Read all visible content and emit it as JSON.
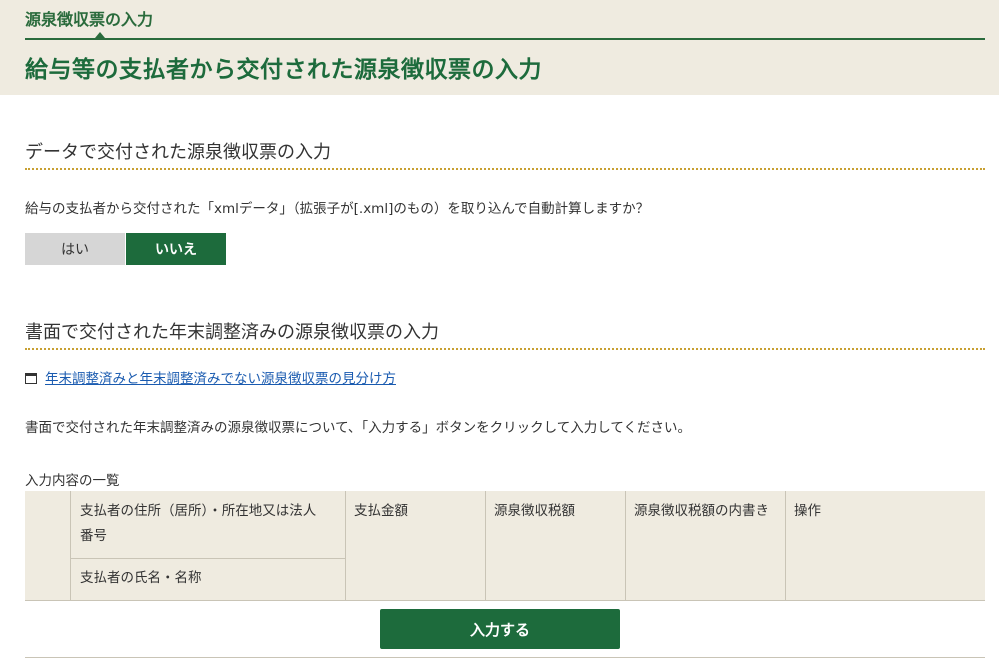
{
  "header": {
    "breadcrumb": "源泉徴収票の入力",
    "title": "給与等の支払者から交付された源泉徴収票の入力"
  },
  "data_section": {
    "title": "データで交付された源泉徴収票の入力",
    "question": "給与の支払者から交付された「xmlデータ」（拡張子が[.xml]のもの）を取り込んで自動計算しますか？",
    "yes_label": "はい",
    "no_label": "いいえ",
    "selected": "いいえ",
    "colors": {
      "selected_bg": "#1d6b3c",
      "unselected_bg": "#d6d6d6"
    }
  },
  "paper_section": {
    "title": "書面で交付された年末調整済みの源泉徴収票の入力",
    "link_text": "年末調整済みと年末調整済みでない源泉徴収票の見分け方",
    "link_icon": "new-window-icon",
    "instruction": "書面で交付された年末調整済みの源泉徴収票について、「入力する」ボタンをクリックして入力してください。",
    "table_caption": "入力内容の一覧",
    "table_headers": {
      "payer_address_line1": "支払者の住所（居所）・所在地又は法人",
      "payer_address_line2": "番号",
      "payer_name": "支払者の氏名・名称",
      "payment_amount": "支払金額",
      "withholding_tax": "源泉徴収税額",
      "withholding_tax_breakdown": "源泉徴収税額の内書き",
      "operation": "操作"
    },
    "input_button": "入力する"
  },
  "colors": {
    "brand_green": "#1d6b3c",
    "header_bg": "#efebe0",
    "dotted_rule": "#c8a032",
    "link": "#1a5bb0"
  }
}
